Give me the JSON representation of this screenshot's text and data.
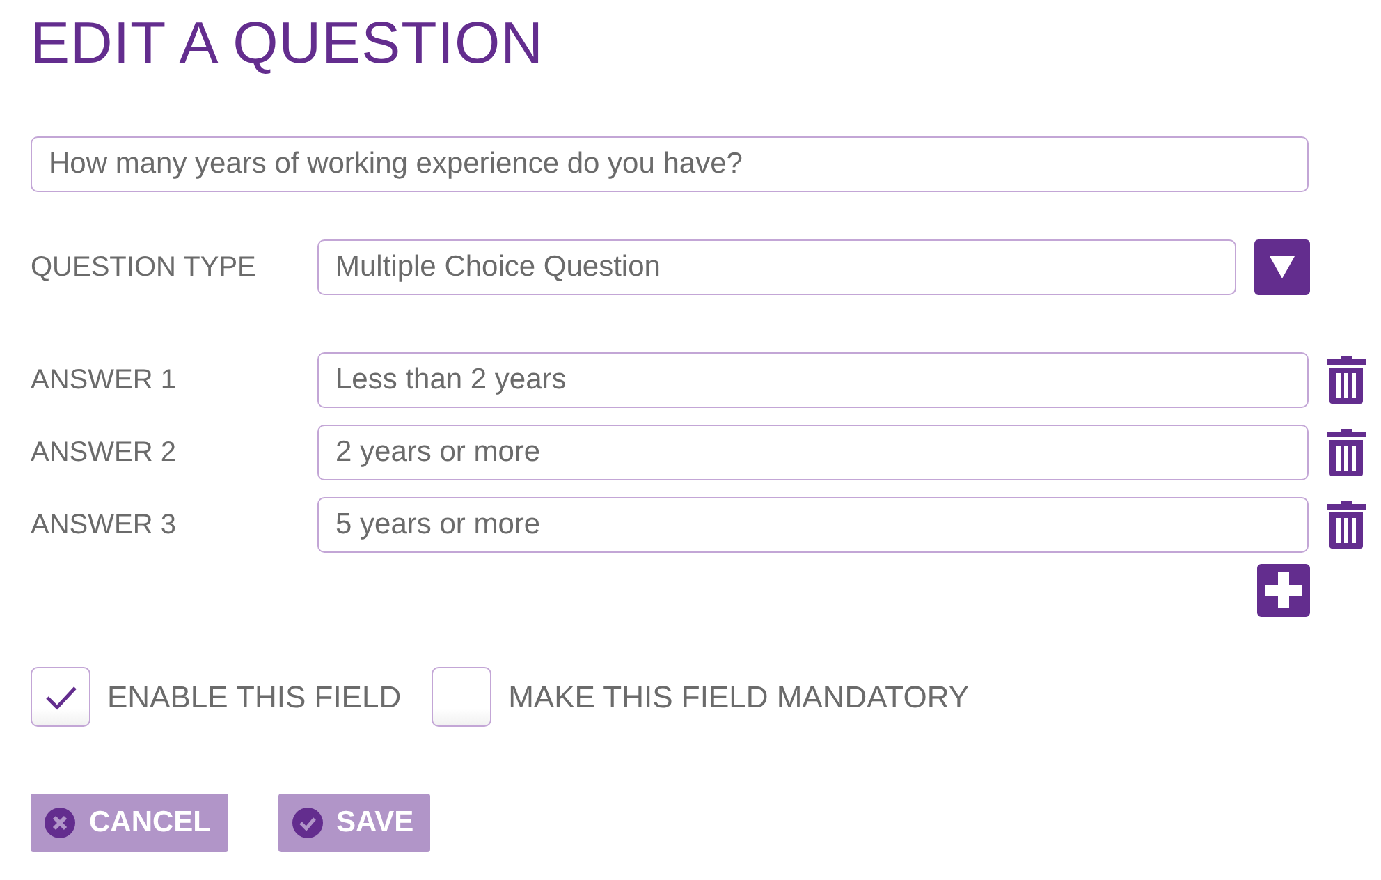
{
  "title": "EDIT A QUESTION",
  "question": {
    "value": "How many years of working experience do you have?"
  },
  "question_type": {
    "label": "QUESTION TYPE",
    "value": "Multiple Choice Question"
  },
  "answers": [
    {
      "label": "ANSWER 1",
      "value": "Less than 2 years"
    },
    {
      "label": "ANSWER 2",
      "value": "2 years or more"
    },
    {
      "label": "ANSWER 3",
      "value": "5 years or more"
    }
  ],
  "options": [
    {
      "label": "ENABLE THIS FIELD",
      "checked": true
    },
    {
      "label": "MAKE THIS FIELD MANDATORY",
      "checked": false
    }
  ],
  "buttons": [
    {
      "label": "CANCEL",
      "kind": "cancel"
    },
    {
      "label": "SAVE",
      "kind": "save"
    }
  ]
}
